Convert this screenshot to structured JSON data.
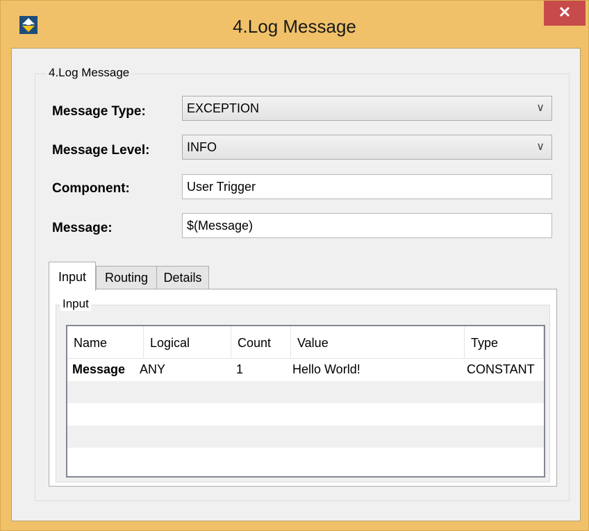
{
  "window": {
    "title": "4.Log Message",
    "close_glyph": "✕",
    "icon": "up-down-arrow-icon"
  },
  "group": {
    "legend": "4.Log Message"
  },
  "form": {
    "message_type": {
      "label": "Message Type:",
      "value": "EXCEPTION"
    },
    "message_level": {
      "label": "Message Level:",
      "value": "INFO"
    },
    "component": {
      "label": "Component:",
      "value": "User Trigger"
    },
    "message": {
      "label": "Message:",
      "value": "$(Message)"
    }
  },
  "tabs": [
    {
      "label": "Input",
      "active": true
    },
    {
      "label": "Routing",
      "active": false
    },
    {
      "label": "Details",
      "active": false
    }
  ],
  "input_panel": {
    "legend": "Input",
    "columns": [
      "Name",
      "Logical",
      "Count",
      "Value",
      "Type"
    ],
    "rows": [
      {
        "name": "Message",
        "logical": "ANY",
        "count": "1",
        "value": "Hello World!",
        "type": "CONSTANT"
      }
    ]
  },
  "colors": {
    "frame": "#f0c169",
    "close": "#c74b4b",
    "panel": "#f0f0f0"
  }
}
